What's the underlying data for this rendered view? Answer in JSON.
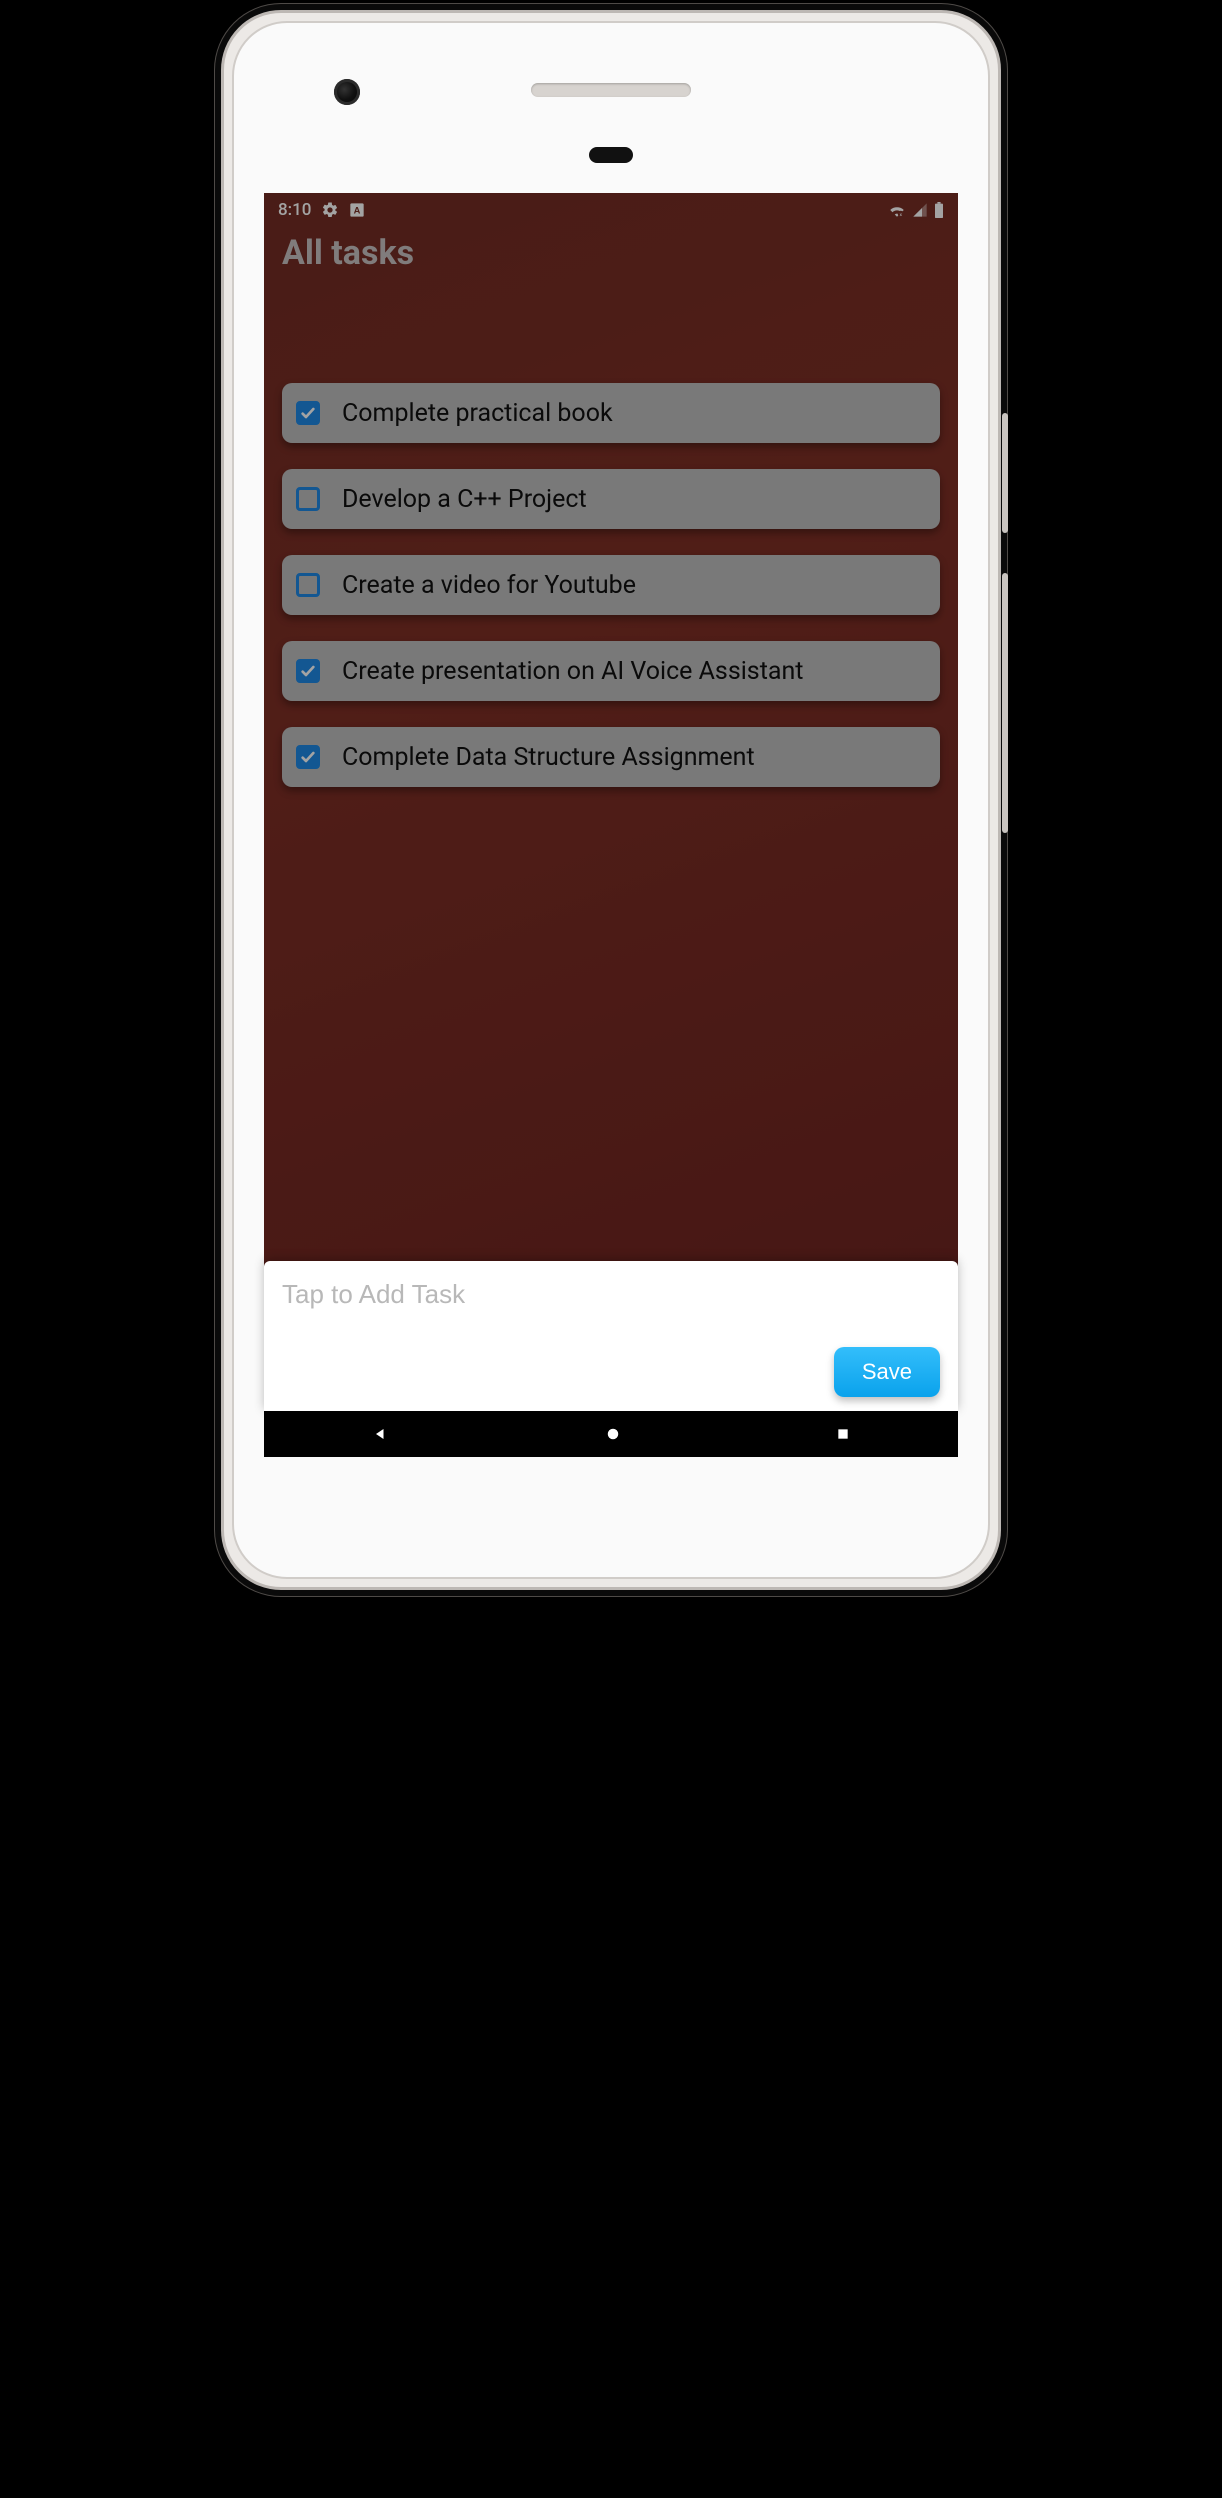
{
  "status_bar": {
    "time": "8:10",
    "icons_left": [
      "gear-icon",
      "square-a-icon"
    ],
    "icons_right": [
      "wifi-icon",
      "signal-icon",
      "battery-icon"
    ]
  },
  "header": {
    "title": "All tasks"
  },
  "tasks": [
    {
      "label": "Complete practical book",
      "checked": true
    },
    {
      "label": "Develop a C++ Project",
      "checked": false
    },
    {
      "label": "Create a video for Youtube",
      "checked": false
    },
    {
      "label": "Create presentation on AI Voice Assistant",
      "checked": true
    },
    {
      "label": "Complete Data Structure Assignment",
      "checked": true
    }
  ],
  "sheet": {
    "input_value": "",
    "input_placeholder": "Tap to Add Task",
    "save_label": "Save"
  },
  "colors": {
    "accent": "#1e88e5",
    "save_button": "#1aa8f2"
  },
  "navbar": {
    "buttons": [
      "back",
      "home",
      "recents"
    ]
  }
}
